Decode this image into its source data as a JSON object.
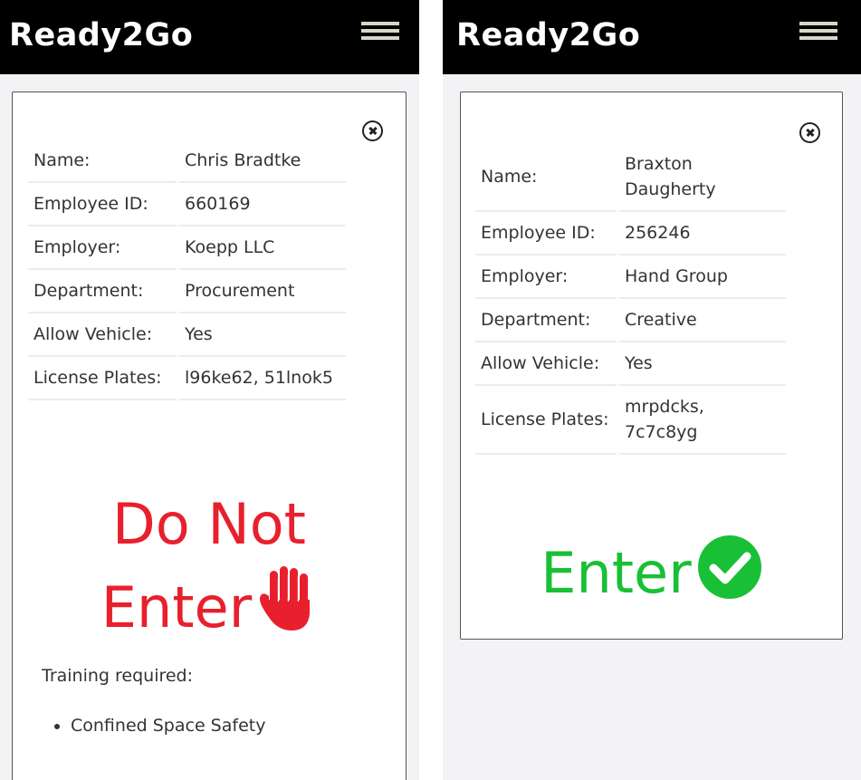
{
  "app": {
    "brand": "Ready2Go"
  },
  "screens": [
    {
      "rows": [
        {
          "label": "Name:",
          "value": "Chris Bradtke"
        },
        {
          "label": "Employee ID:",
          "value": "660169"
        },
        {
          "label": "Employer:",
          "value": "Koepp LLC"
        },
        {
          "label": "Department:",
          "value": "Procurement"
        },
        {
          "label": "Allow Vehicle:",
          "value": "Yes"
        },
        {
          "label": "License Plates:",
          "value": "l96ke62, 51lnok5"
        }
      ],
      "status": {
        "line1": "Do Not",
        "line2": "Enter",
        "color": "#e8202e",
        "icon": "stop-hand-icon"
      },
      "training": {
        "label": "Training required:",
        "items": [
          "Confined Space Safety"
        ]
      }
    },
    {
      "rows": [
        {
          "label": "Name:",
          "value": "Braxton Daugherty"
        },
        {
          "label": "Employee ID:",
          "value": "256246"
        },
        {
          "label": "Employer:",
          "value": "Hand Group"
        },
        {
          "label": "Department:",
          "value": "Creative"
        },
        {
          "label": "Allow Vehicle:",
          "value": "Yes"
        },
        {
          "label": "License Plates:",
          "value": "mrpdcks, 7c7c8yg"
        }
      ],
      "status": {
        "line1": "Enter",
        "color": "#19c036",
        "icon": "checkmark-circle-icon"
      }
    }
  ],
  "colors": {
    "header_bg": "#000000",
    "deny": "#e8202e",
    "allow": "#19c036",
    "menu_icon": "#d8d6c8"
  }
}
